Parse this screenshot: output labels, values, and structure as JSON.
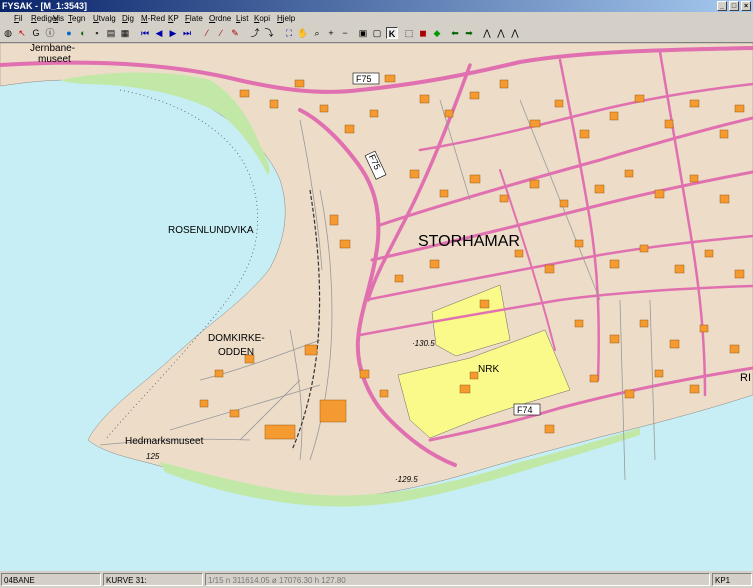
{
  "window": {
    "title": "FYSAK - [M_1:3543]",
    "min": "_",
    "max": "□",
    "close": "×"
  },
  "menu": [
    "Fil",
    "Rediger",
    "Vis",
    "Tegn",
    "Utvalg",
    "Dig",
    "M-Red",
    "KP",
    "Flate",
    "Ordne",
    "List",
    "Kopi",
    "Hjelp"
  ],
  "map": {
    "labels": {
      "jernbane_1": "Jernbane-",
      "jernbane_2": "museet",
      "rosenlundvika": "ROSENLUNDVIKA",
      "storhamar": "STORHAMAR",
      "domkirke_1": "DOMKIRKE-",
      "domkirke_2": "ODDEN",
      "nrk": "NRK",
      "hedmark": "Hedmarksmuseet",
      "ri": "RI",
      "f75a": "F75",
      "f75b": "F75",
      "f74": "F74",
      "h130": "·130.5",
      "h129": "·129.5",
      "h125": "125"
    }
  },
  "status": {
    "layer": "04BANE",
    "curve": "KURVE 31:",
    "coords": "1/15  n 311614.05  ø 17076.30  h 127.80",
    "kp": "KP1"
  }
}
